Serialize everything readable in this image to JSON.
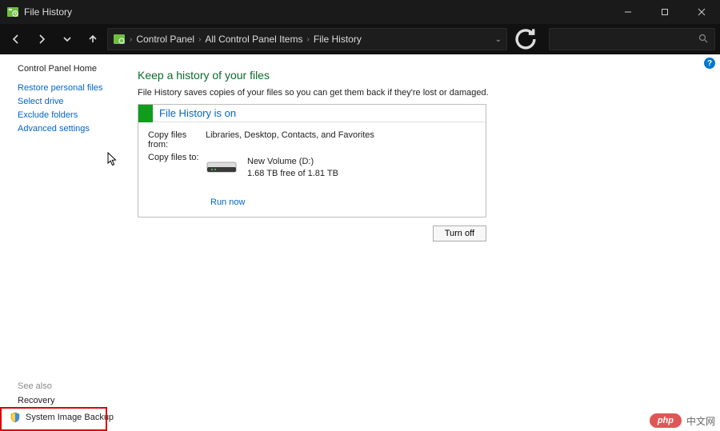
{
  "titlebar": {
    "title": "File History"
  },
  "breadcrumb": {
    "items": [
      "Control Panel",
      "All Control Panel Items",
      "File History"
    ]
  },
  "sidebar": {
    "home": "Control Panel Home",
    "links": [
      "Restore personal files",
      "Select drive",
      "Exclude folders",
      "Advanced settings"
    ],
    "see_also": "See also",
    "recovery": "Recovery",
    "system_image_backup": "System Image Backup"
  },
  "main": {
    "heading": "Keep a history of your files",
    "description": "File History saves copies of your files so you can get them back if they're lost or damaged.",
    "status_title": "File History is on",
    "copy_from_label": "Copy files from:",
    "copy_from_value": "Libraries, Desktop, Contacts, and Favorites",
    "copy_to_label": "Copy files to:",
    "drive_name": "New Volume (D:)",
    "drive_space": "1.68 TB free of 1.81 TB",
    "run_now": "Run now",
    "turn_off": "Turn off"
  },
  "help_badge": "?",
  "watermark": {
    "brand": "php",
    "text": "中文网"
  }
}
